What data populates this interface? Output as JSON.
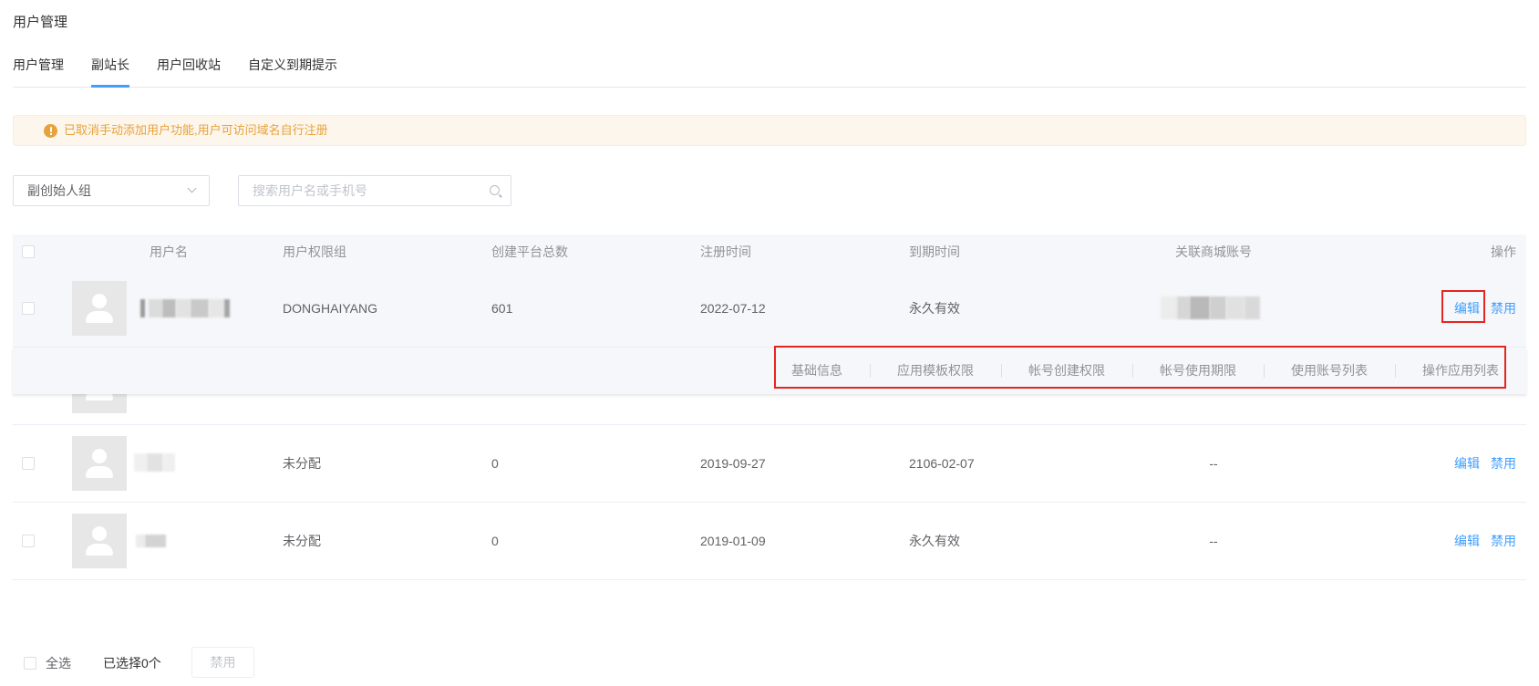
{
  "page": {
    "title": "用户管理"
  },
  "tabs": {
    "active_index": 1,
    "items": [
      {
        "label": "用户管理"
      },
      {
        "label": "副站长"
      },
      {
        "label": "用户回收站"
      },
      {
        "label": "自定义到期提示"
      }
    ]
  },
  "alert": {
    "text": "已取消手动添加用户功能,用户可访问域名自行注册"
  },
  "filters": {
    "group_select": {
      "value": "副创始人组"
    },
    "search": {
      "placeholder": "搜索用户名或手机号"
    }
  },
  "table": {
    "headers": {
      "username": "用户名",
      "group": "用户权限组",
      "platform_count": "创建平台总数",
      "registered": "注册时间",
      "expires": "到期时间",
      "store_account": "关联商城账号",
      "actions": "操作"
    },
    "rows": [
      {
        "group": "DONGHAIYANG",
        "platform_count": "601",
        "registered": "2022-07-12",
        "expires": "永久有效",
        "edit": "编辑",
        "disable": "禁用"
      },
      {
        "group": "未分配",
        "platform_count": "0",
        "registered": "2019-09-27",
        "expires": "2106-02-07",
        "store_account": "--",
        "edit": "编辑",
        "disable": "禁用"
      },
      {
        "group": "未分配",
        "platform_count": "0",
        "registered": "2019-01-09",
        "expires": "永久有效",
        "store_account": "--",
        "edit": "编辑",
        "disable": "禁用"
      }
    ],
    "expand_menu": [
      "基础信息",
      "应用模板权限",
      "帐号创建权限",
      "帐号使用期限",
      "使用账号列表",
      "操作应用列表"
    ]
  },
  "footer": {
    "select_all": "全选",
    "selected_count": "已选择0个",
    "disable_button": "禁用"
  },
  "icons": {
    "alert": "warning-icon",
    "select": "chevron-down-icon",
    "search": "search-icon",
    "avatar": "user-avatar-icon"
  },
  "colors": {
    "accent": "#409eff",
    "warning": "#e6a23c",
    "warning_bg": "#fdf6ec",
    "header_bg": "#f5f7fa",
    "text": "#606266",
    "muted": "#909399",
    "annotation": "#e5261f"
  }
}
